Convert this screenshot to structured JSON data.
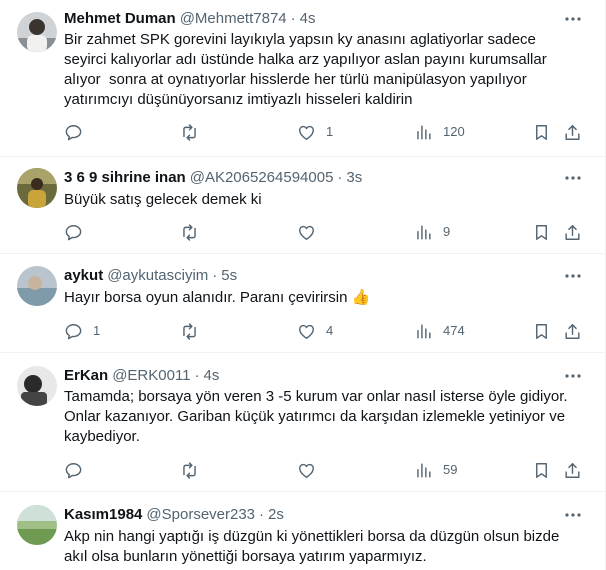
{
  "tweets": [
    {
      "name": "Mehmet Duman",
      "handle": "@Mehmett7874",
      "separator": "·",
      "time": "4s",
      "text": "Bir zahmet SPK gorevini layıkıyla yapsın ky anasını aglatiyorlar sadece\nseyirci kalıyorlar adı üstünde halka arz yapılıyor aslan payını kurumsallar\nalıyor  sonra at oynatıyorlar hisslerde her türlü manipülasyon yapılıyor\nyatırımcıyı düşünüyorsanız imtiyazlı hisseleri kaldirin",
      "counts": {
        "replies": "",
        "retweets": "",
        "likes": "1",
        "views": "120"
      }
    },
    {
      "name": "3 6 9 sihrine inan",
      "handle": "@AK2065264594005",
      "separator": "·",
      "time": "3s",
      "text": "Büyük satış gelecek demek ki",
      "counts": {
        "replies": "",
        "retweets": "",
        "likes": "",
        "views": "9"
      }
    },
    {
      "name": "aykut",
      "handle": "@aykutasciyim",
      "separator": "·",
      "time": "5s",
      "text": "Hayır borsa oyun alanıdır. Paranı çevirirsin",
      "emoji": "👍",
      "counts": {
        "replies": "1",
        "retweets": "",
        "likes": "4",
        "views": "474"
      }
    },
    {
      "name": "ErKan",
      "handle": "@ERK0011",
      "separator": "·",
      "time": "4s",
      "text": "Tamamda; borsaya yön veren 3 -5 kurum var onlar nasıl isterse öyle gidiyor.\nOnlar kazanıyor. Gariban küçük yatırımcı da karşıdan izlemekle yetiniyor ve\nkaybediyor.",
      "counts": {
        "replies": "",
        "retweets": "",
        "likes": "",
        "views": "59"
      }
    },
    {
      "name": "Kasım1984",
      "handle": "@Sporsever233",
      "separator": "·",
      "time": "2s",
      "text": "Akp nin hangi yaptığı iş düzgün ki yönettikleri borsa da düzgün olsun bizde\nakıl olsa bunların yönettiği borsaya yatırım yaparmıyız.",
      "counts": {
        "replies": "",
        "retweets": "",
        "likes": "",
        "views": ""
      }
    }
  ],
  "icons": {
    "reply": "reply-icon",
    "retweet": "retweet-icon",
    "like": "heart-icon",
    "views": "views-icon",
    "bookmark": "bookmark-icon",
    "share": "share-icon",
    "more": "more-icon"
  },
  "colors": {
    "text": "#0f1419",
    "secondary": "#536471",
    "divider": "#eff3f4",
    "emoji": "#f2b705"
  }
}
